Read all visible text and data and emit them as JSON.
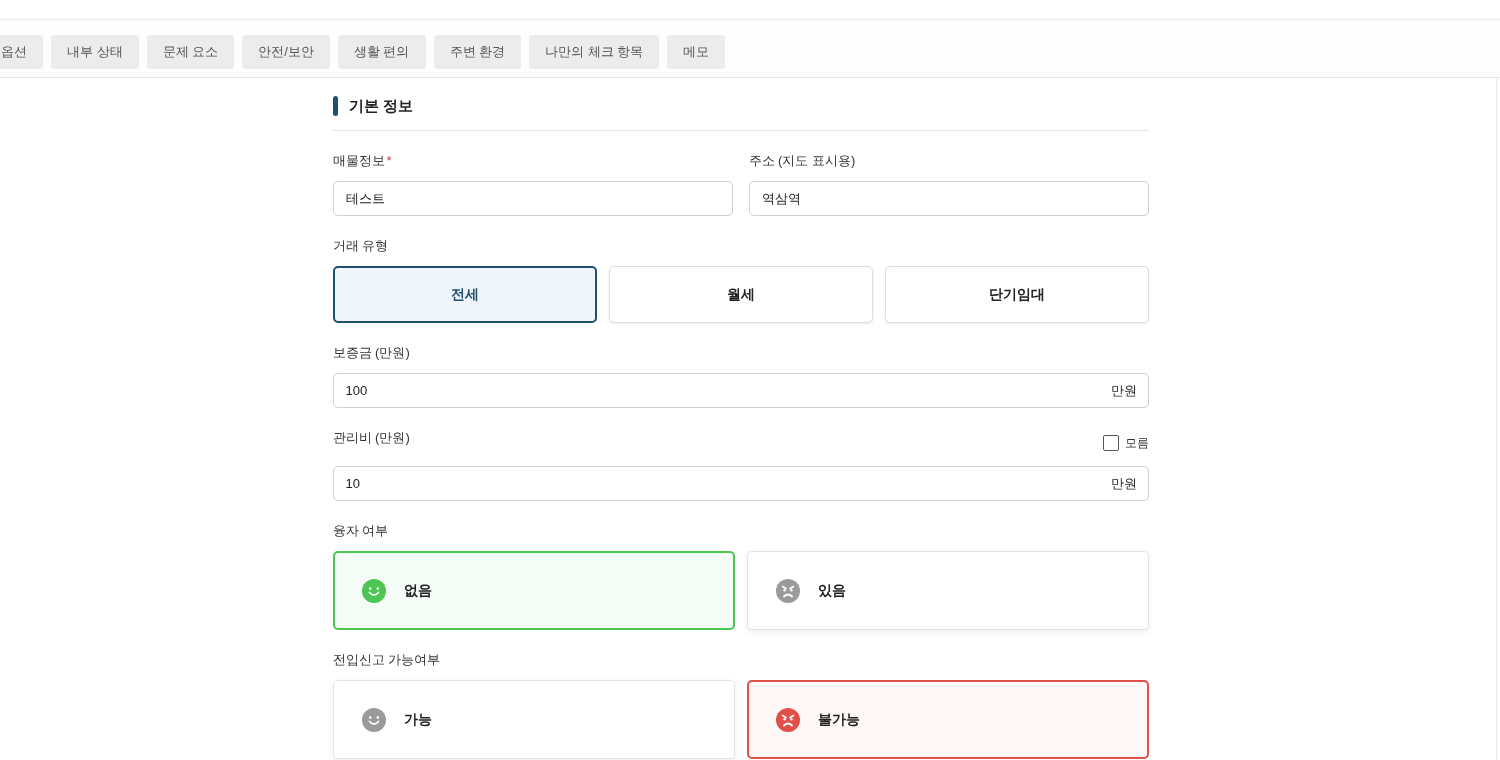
{
  "tabs": [
    {
      "label": "옵션",
      "selected": false
    },
    {
      "label": "내부 상태",
      "selected": false
    },
    {
      "label": "문제 요소",
      "selected": false
    },
    {
      "label": "안전/보안",
      "selected": false
    },
    {
      "label": "생활 편의",
      "selected": false
    },
    {
      "label": "주변 환경",
      "selected": false
    },
    {
      "label": "나만의 체크 항목",
      "selected": false
    },
    {
      "label": "메모",
      "selected": false
    }
  ],
  "section": {
    "title": "기본 정보"
  },
  "property_info": {
    "label": "매물정보",
    "required_mark": "*",
    "value": "테스트"
  },
  "address": {
    "label": "주소 (지도 표시용)",
    "value": "역삼역"
  },
  "deal_type": {
    "label": "거래 유형",
    "options": [
      {
        "label": "전세",
        "selected": true
      },
      {
        "label": "월세",
        "selected": false
      },
      {
        "label": "단기임대",
        "selected": false
      }
    ]
  },
  "deposit": {
    "label": "보증금 (만원)",
    "value": "100",
    "unit": "만원"
  },
  "maintenance_fee": {
    "label": "관리비 (만원)",
    "value": "10",
    "unit": "만원",
    "unknown": {
      "label": "모름",
      "checked": false
    }
  },
  "loan": {
    "label": "융자 여부",
    "options": [
      {
        "label": "없음",
        "selected": true,
        "kind": "good"
      },
      {
        "label": "있음",
        "selected": false,
        "kind": "bad"
      }
    ]
  },
  "move_in_report": {
    "label": "전입신고 가능여부",
    "options": [
      {
        "label": "가능",
        "selected": false,
        "kind": "good"
      },
      {
        "label": "불가능",
        "selected": true,
        "kind": "bad"
      }
    ]
  }
}
